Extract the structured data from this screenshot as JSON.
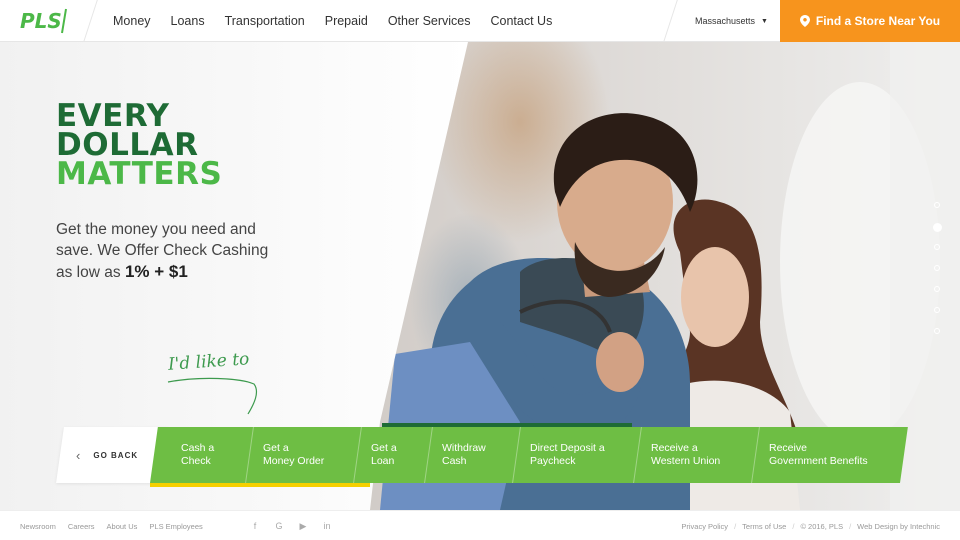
{
  "header": {
    "logo_text": "PLS",
    "nav": [
      "Money",
      "Loans",
      "Transportation",
      "Prepaid",
      "Other Services",
      "Contact Us"
    ],
    "region": "Massachusetts",
    "store_button": "Find a Store Near You"
  },
  "hero": {
    "headline": [
      "EVERY",
      "DOLLAR",
      "MATTERS"
    ],
    "subtext": "Get the money you need and save. We Offer Check Cashing as low as",
    "subtext_bold": "1% + $1",
    "handwriting": "I'd like to",
    "slide_dots": 7,
    "active_dot": 2
  },
  "actions": {
    "go_back": "GO BACK",
    "items": [
      {
        "line1": "Cash a",
        "line2": "Check"
      },
      {
        "line1": "Get a",
        "line2": "Money Order"
      },
      {
        "line1": "Get a",
        "line2": "Loan"
      },
      {
        "line1": "Withdraw",
        "line2": "Cash"
      },
      {
        "line1": "Direct Deposit a",
        "line2": "Paycheck"
      },
      {
        "line1": "Receive a",
        "line2": "Western Union"
      },
      {
        "line1": "Receive",
        "line2": "Government Benefits"
      }
    ]
  },
  "footer": {
    "links": [
      "Newsroom",
      "Careers",
      "About Us",
      "PLS Employees"
    ],
    "social": [
      "facebook-icon",
      "google-plus-icon",
      "youtube-icon",
      "linkedin-icon"
    ],
    "right": [
      "Privacy Policy",
      "Terms of Use",
      "© 2016, PLS",
      "Web Design by Intechnic"
    ]
  },
  "colors": {
    "brand_green": "#4cb848",
    "dark_green": "#1e6b35",
    "action_green": "#6ebe44",
    "orange": "#f7941d",
    "yellow": "#f5d000"
  }
}
